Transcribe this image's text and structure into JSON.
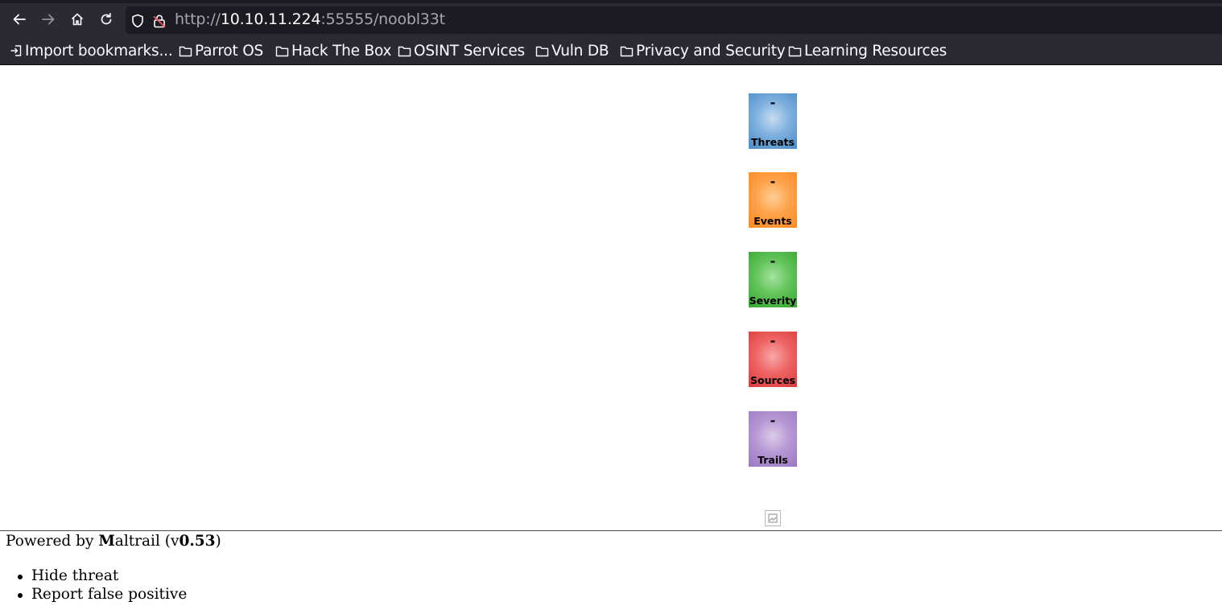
{
  "browser": {
    "url_scheme": "http://",
    "url_host": "10.10.11.224",
    "url_rest": ":55555/noobl33t",
    "bookmarks": [
      {
        "label": "Import bookmarks...",
        "icon": "import-icon"
      },
      {
        "label": "Parrot OS",
        "icon": "folder-icon"
      },
      {
        "label": "Hack The Box",
        "icon": "folder-icon"
      },
      {
        "label": "OSINT Services",
        "icon": "folder-icon"
      },
      {
        "label": "Vuln DB",
        "icon": "folder-icon"
      },
      {
        "label": "Privacy and Security",
        "icon": "folder-icon"
      },
      {
        "label": "Learning Resources",
        "icon": "folder-icon"
      }
    ]
  },
  "counters": [
    {
      "value": "-",
      "label": "Threats",
      "color": "#7eb0de"
    },
    {
      "value": "-",
      "label": "Events",
      "color": "#ffa24a"
    },
    {
      "value": "-",
      "label": "Severity",
      "color": "#62c35a"
    },
    {
      "value": "-",
      "label": "Sources",
      "color": "#ee6464"
    },
    {
      "value": "-",
      "label": "Trails",
      "color": "#b697d4"
    }
  ],
  "footer": {
    "powered_by": "Powered by ",
    "brand_initial": "M",
    "brand_rest": "altrail",
    "version_open": " (v",
    "version": "0.53",
    "version_close": ")"
  },
  "menu": [
    {
      "label": "Hide threat"
    },
    {
      "label": "Report false positive"
    }
  ]
}
